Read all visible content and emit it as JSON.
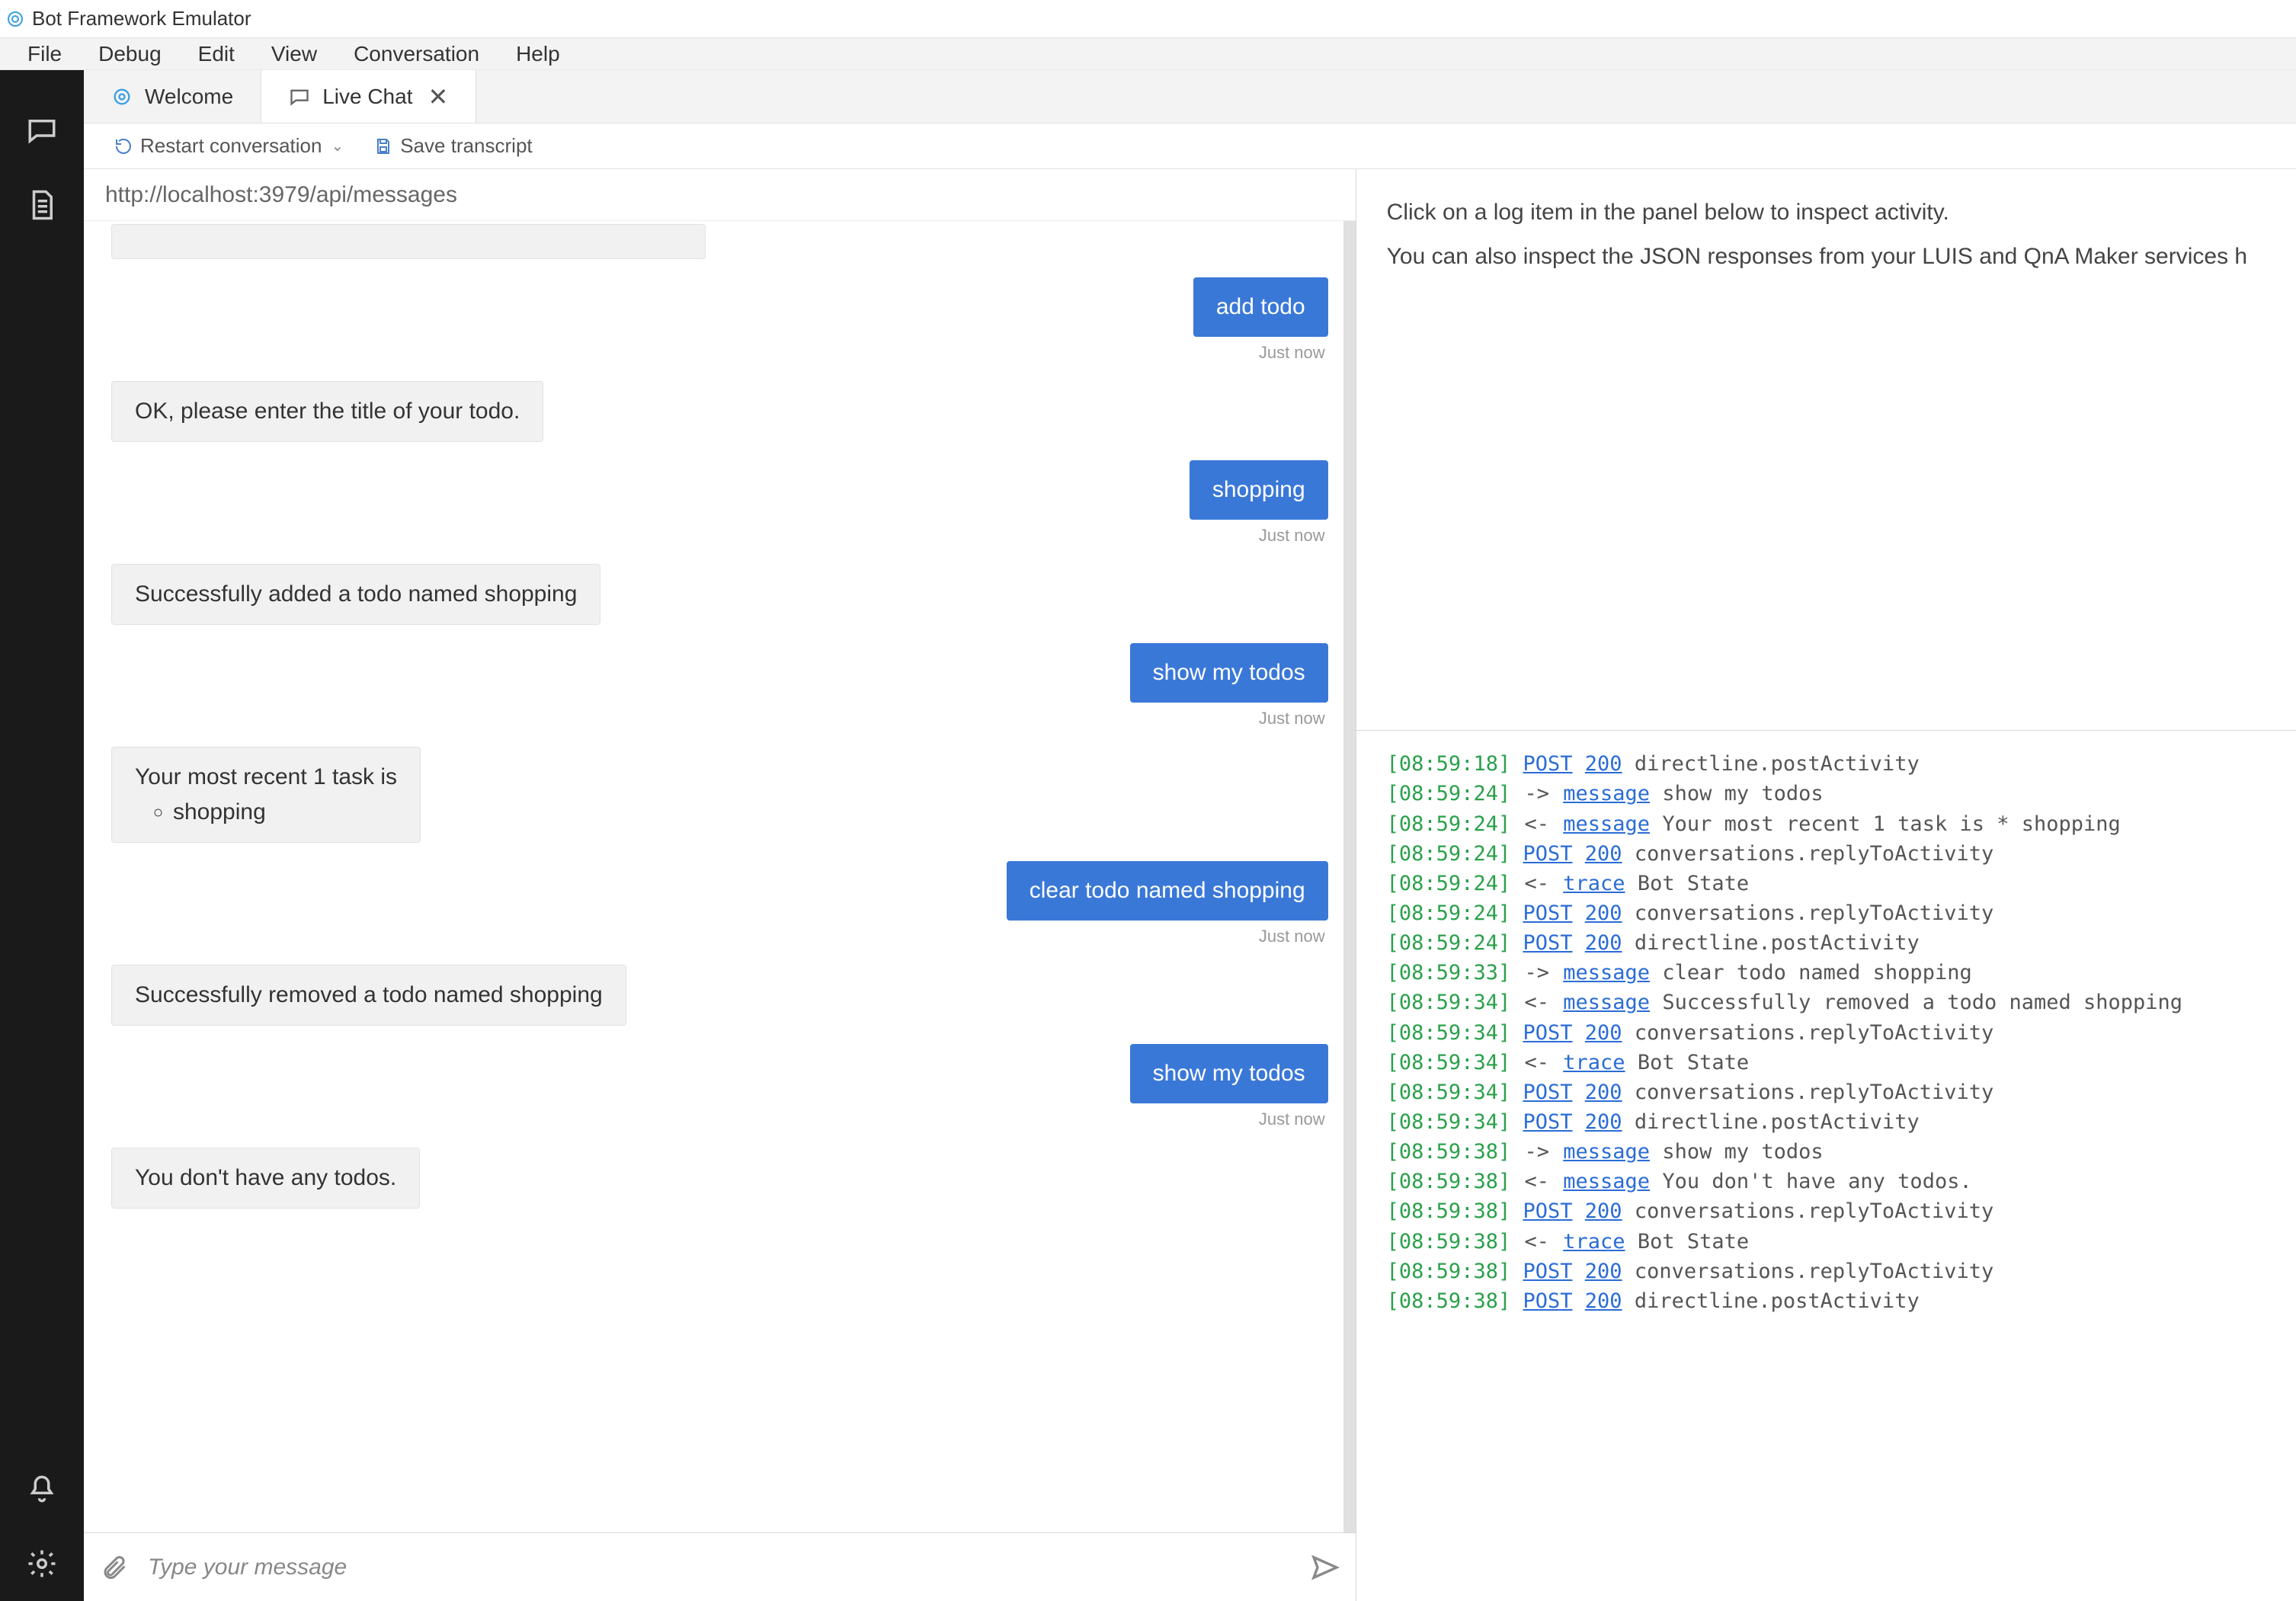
{
  "titlebar": {
    "app_name": "Bot Framework Emulator"
  },
  "menubar": {
    "items": [
      "File",
      "Debug",
      "Edit",
      "View",
      "Conversation",
      "Help"
    ]
  },
  "tabs": [
    {
      "label": "Welcome",
      "active": false,
      "closable": false
    },
    {
      "label": "Live Chat",
      "active": true,
      "closable": true
    }
  ],
  "toolbar": {
    "restart_label": "Restart conversation",
    "save_transcript_label": "Save transcript"
  },
  "address_bar": {
    "url": "http://localhost:3979/api/messages"
  },
  "chat": {
    "messages": [
      {
        "from": "bot",
        "partial_top": true,
        "text": ""
      },
      {
        "from": "user",
        "text": "add todo",
        "ts": "Just now"
      },
      {
        "from": "bot",
        "text": "OK, please enter the title of your todo."
      },
      {
        "from": "user",
        "text": "shopping",
        "ts": "Just now"
      },
      {
        "from": "bot",
        "text": "Successfully added a todo named shopping"
      },
      {
        "from": "user",
        "text": "show my todos",
        "ts": "Just now"
      },
      {
        "from": "bot",
        "text": "Your most recent 1 task is",
        "list": [
          "shopping"
        ]
      },
      {
        "from": "user",
        "text": "clear todo named shopping",
        "ts": "Just now"
      },
      {
        "from": "bot",
        "text": "Successfully removed a todo named shopping"
      },
      {
        "from": "user",
        "text": "show my todos",
        "ts": "Just now"
      },
      {
        "from": "bot",
        "text": "You don't have any todos."
      }
    ],
    "input_placeholder": "Type your message"
  },
  "inspector": {
    "hint_line1": "Click on a log item in the panel below to inspect activity.",
    "hint_line2": "You can also inspect the JSON responses from your LUIS and QnA Maker services h"
  },
  "log": [
    {
      "ts": "08:59:18",
      "dir": "",
      "link": "POST",
      "code": "200",
      "text": "directline.postActivity"
    },
    {
      "ts": "08:59:24",
      "dir": "->",
      "link": "message",
      "text": "show my todos"
    },
    {
      "ts": "08:59:24",
      "dir": "<-",
      "link": "message",
      "text": "Your most recent 1 task is * shopping"
    },
    {
      "ts": "08:59:24",
      "dir": "",
      "link": "POST",
      "code": "200",
      "text": "conversations.replyToActivity"
    },
    {
      "ts": "08:59:24",
      "dir": "<-",
      "link": "trace",
      "text": "Bot State"
    },
    {
      "ts": "08:59:24",
      "dir": "",
      "link": "POST",
      "code": "200",
      "text": "conversations.replyToActivity"
    },
    {
      "ts": "08:59:24",
      "dir": "",
      "link": "POST",
      "code": "200",
      "text": "directline.postActivity"
    },
    {
      "ts": "08:59:33",
      "dir": "->",
      "link": "message",
      "text": "clear todo named shopping"
    },
    {
      "ts": "08:59:34",
      "dir": "<-",
      "link": "message",
      "text": "Successfully removed a todo named shopping"
    },
    {
      "ts": "08:59:34",
      "dir": "",
      "link": "POST",
      "code": "200",
      "text": "conversations.replyToActivity"
    },
    {
      "ts": "08:59:34",
      "dir": "<-",
      "link": "trace",
      "text": "Bot State"
    },
    {
      "ts": "08:59:34",
      "dir": "",
      "link": "POST",
      "code": "200",
      "text": "conversations.replyToActivity"
    },
    {
      "ts": "08:59:34",
      "dir": "",
      "link": "POST",
      "code": "200",
      "text": "directline.postActivity"
    },
    {
      "ts": "08:59:38",
      "dir": "->",
      "link": "message",
      "text": "show my todos"
    },
    {
      "ts": "08:59:38",
      "dir": "<-",
      "link": "message",
      "text": "You don't have any todos."
    },
    {
      "ts": "08:59:38",
      "dir": "",
      "link": "POST",
      "code": "200",
      "text": "conversations.replyToActivity"
    },
    {
      "ts": "08:59:38",
      "dir": "<-",
      "link": "trace",
      "text": "Bot State"
    },
    {
      "ts": "08:59:38",
      "dir": "",
      "link": "POST",
      "code": "200",
      "text": "conversations.replyToActivity"
    },
    {
      "ts": "08:59:38",
      "dir": "",
      "link": "POST",
      "code": "200",
      "text": "directline.postActivity"
    }
  ]
}
